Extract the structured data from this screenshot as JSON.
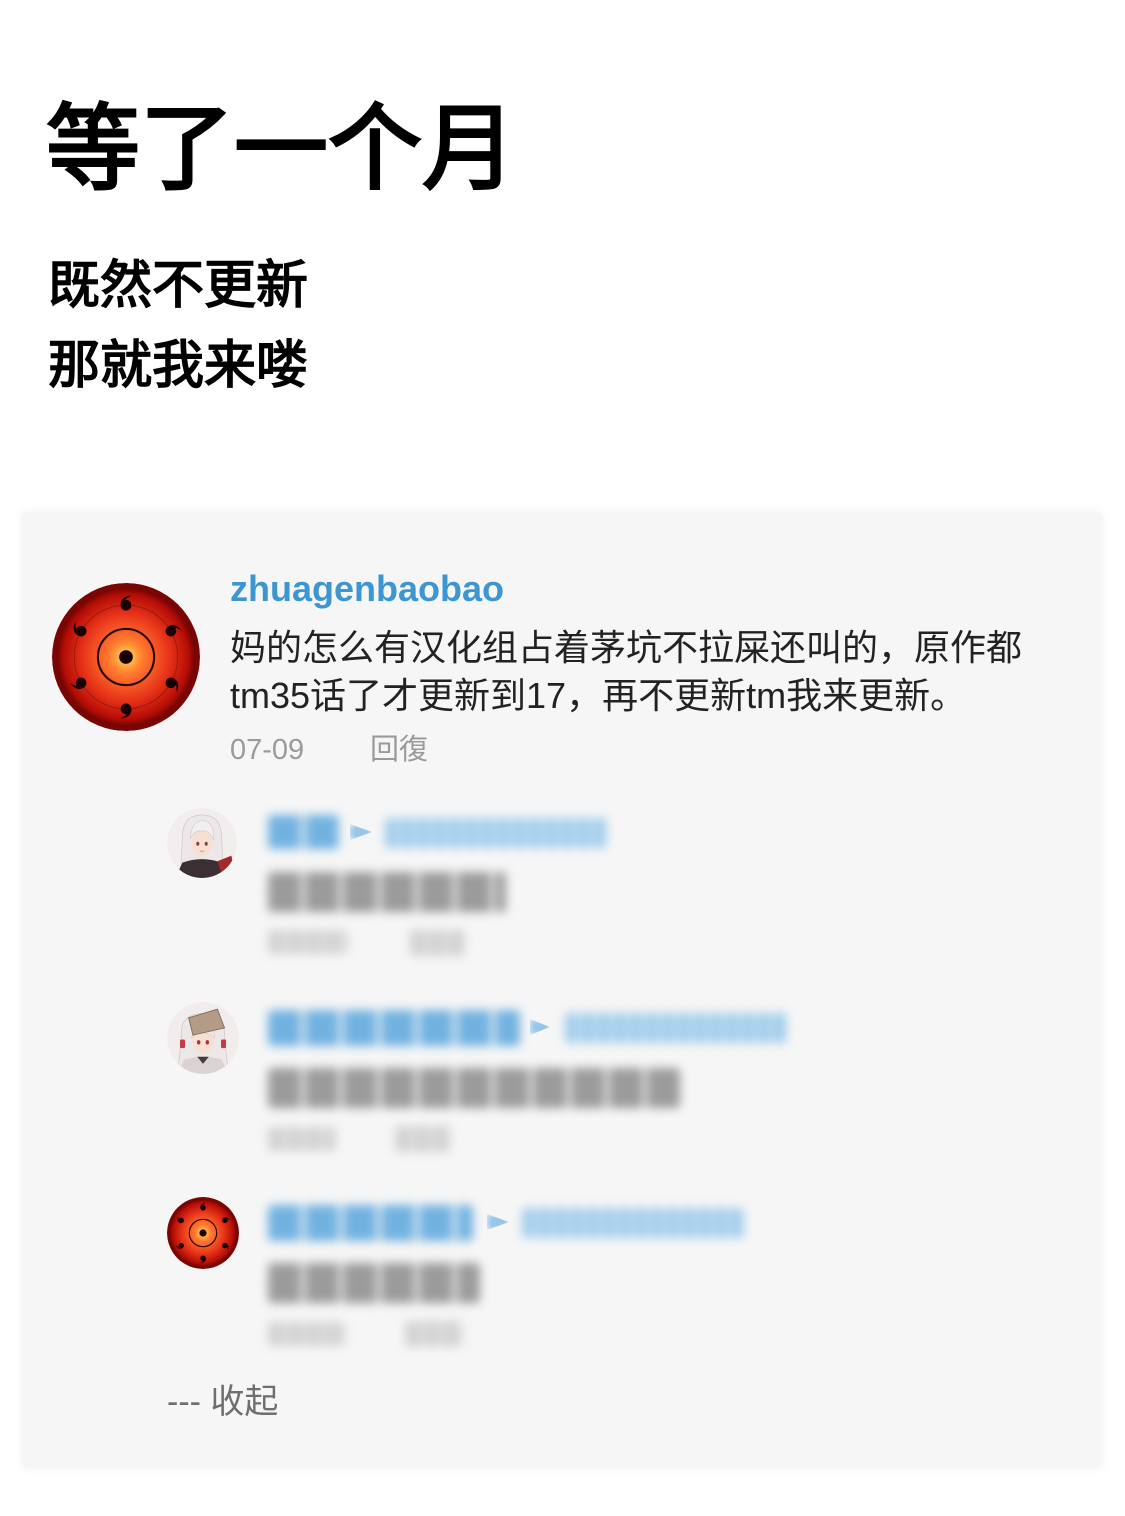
{
  "post": {
    "title": "等了一个月",
    "subtitle_lines": [
      "既然不更新",
      "那就我来喽"
    ]
  },
  "comment": {
    "avatar_icon": "sharingan-avatar-icon",
    "username": "zhuagenbaobao",
    "text": "妈的怎么有汉化组占着茅坑不拉屎还叫的，原作都tm35话了才更新到17，再不更新tm我来更新。",
    "date": "07-09",
    "reply_label": "回復"
  },
  "replies": [
    {
      "avatar_icon": "white-haired-girl-avatar-icon",
      "blurred": true
    },
    {
      "avatar_icon": "hat-girl-avatar-icon",
      "blurred": true
    },
    {
      "avatar_icon": "sharingan-avatar-icon",
      "blurred": true
    }
  ],
  "collapse_label": "--- 收起",
  "colors": {
    "username": "#3b96d1",
    "text": "#222222",
    "meta": "#9a9a9a",
    "card": "#f6f6f6"
  }
}
